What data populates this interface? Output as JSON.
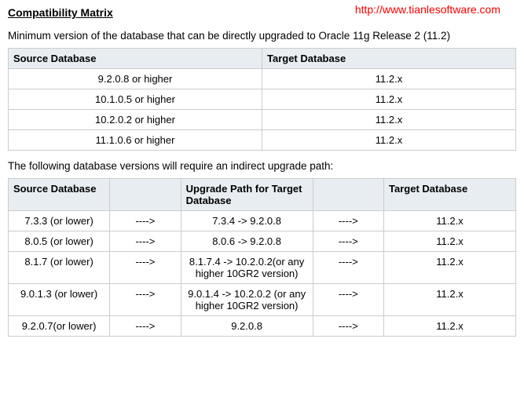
{
  "header": {
    "title": "Compatibility Matrix",
    "watermark": "http://www.tianlesoftware.com"
  },
  "section1": {
    "desc": "Minimum version of the database that can be directly upgraded to Oracle 11g Release 2 (11.2)",
    "headers": [
      "Source Database",
      "Target Database"
    ],
    "rows": [
      [
        "9.2.0.8 or higher",
        "11.2.x"
      ],
      [
        "10.1.0.5 or higher",
        "11.2.x"
      ],
      [
        "10.2.0.2 or higher",
        "11.2.x"
      ],
      [
        "11.1.0.6 or higher",
        "11.2.x"
      ]
    ]
  },
  "section2": {
    "desc": "The following database versions will require an indirect upgrade path:",
    "headers": [
      "Source Database",
      "",
      "Upgrade Path for Target Database",
      "",
      "Target Database"
    ],
    "arrow": "---->",
    "rows": [
      [
        "7.3.3 (or lower)",
        "7.3.4 -> 9.2.0.8",
        "11.2.x"
      ],
      [
        "8.0.5 (or lower)",
        "8.0.6 -> 9.2.0.8",
        "11.2.x"
      ],
      [
        "8.1.7 (or lower)",
        "8.1.7.4 -> 10.2.0.2(or any higher 10GR2 version)",
        "11.2.x"
      ],
      [
        "9.0.1.3 (or lower)",
        "9.0.1.4 -> 10.2.0.2 (or any higher 10GR2 version)",
        "11.2.x"
      ],
      [
        "9.2.0.7(or lower)",
        "9.2.0.8",
        "11.2.x"
      ]
    ]
  }
}
